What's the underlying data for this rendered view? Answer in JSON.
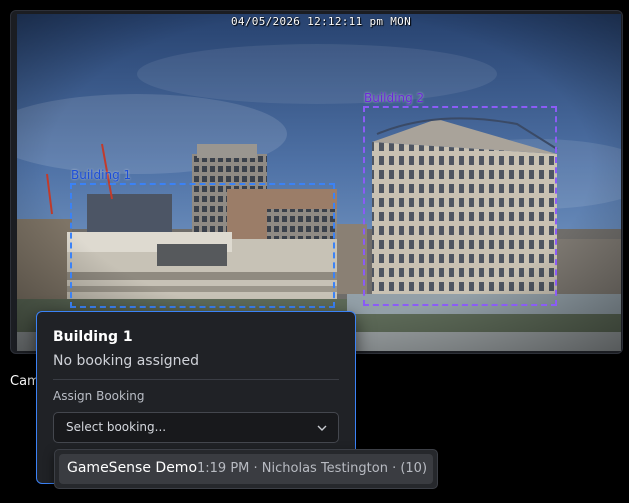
{
  "camera": {
    "timestamp": "04/05/2026 12:12:11 pm MON",
    "caption": "Cam"
  },
  "zones": [
    {
      "label": "Building 1",
      "color": "#3b82f6"
    },
    {
      "label": "Building 2",
      "color": "#8b5cf6"
    }
  ],
  "popover": {
    "title": "Building 1",
    "status": "No booking assigned",
    "assign_label": "Assign Booking",
    "select_placeholder": "Select booking...",
    "select_icon": "chevron-down-icon",
    "accent": "#3b82f6"
  },
  "dropdown": {
    "options": [
      {
        "name": "GameSense Demo",
        "meta": "1:19 PM · Nicholas Testington · (10)"
      }
    ]
  }
}
